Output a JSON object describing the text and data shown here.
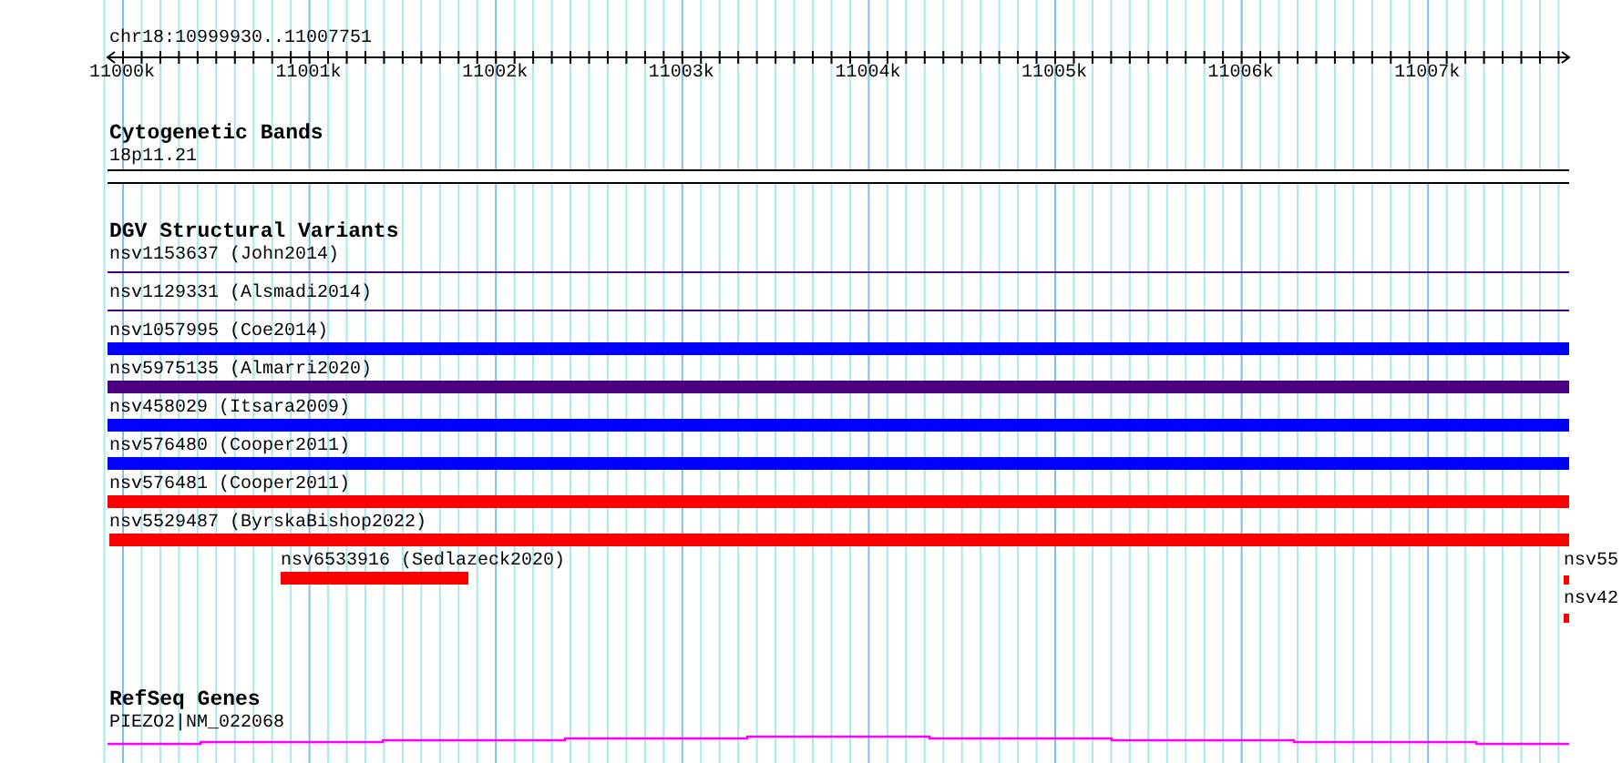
{
  "location": "chr18:10999930..11007751",
  "ruler": {
    "ticks": [
      "11000k",
      "11001k",
      "11002k",
      "11003k",
      "11004k",
      "11005k",
      "11006k",
      "11007k"
    ]
  },
  "tracks": [
    {
      "title": "Cytogenetic Bands",
      "kind": "cytoband",
      "features": [
        {
          "label": "18p11.21",
          "color": "#ffffff"
        }
      ]
    },
    {
      "title": "DGV Structural Variants",
      "kind": "variants",
      "features": [
        {
          "label": "nsv1153637 (John2014)",
          "kind": "line",
          "color": "#4b0082"
        },
        {
          "label": "nsv1129331 (Alsmadi2014)",
          "kind": "line",
          "color": "#4b0082"
        },
        {
          "label": "nsv1057995 (Coe2014)",
          "kind": "bar",
          "color": "#0000ff"
        },
        {
          "label": "nsv5975135 (Almarri2020)",
          "kind": "bar",
          "color": "#4b0082"
        },
        {
          "label": "nsv458029 (Itsara2009)",
          "kind": "bar",
          "color": "#0000ff"
        },
        {
          "label": "nsv576480 (Cooper2011)",
          "kind": "bar",
          "color": "#0000ff"
        },
        {
          "label": "nsv576481 (Cooper2011)",
          "kind": "bar",
          "color": "#ff0000"
        },
        {
          "label": "nsv5529487 (ByrskaBishop2022)",
          "kind": "bar",
          "color": "#ff0000"
        },
        {
          "label": "nsv6533916 (Sedlazeck2020)",
          "kind": "bar",
          "color": "#ff0000"
        },
        {
          "label": "nsv55",
          "kind": "bar",
          "color": "#ff0000"
        },
        {
          "label": "nsv42",
          "kind": "bar",
          "color": "#ff0000"
        }
      ]
    },
    {
      "title": "RefSeq Genes",
      "kind": "gene",
      "features": [
        {
          "label": "PIEZO2|NM_022068",
          "color": "#ff00ff"
        }
      ]
    }
  ]
}
